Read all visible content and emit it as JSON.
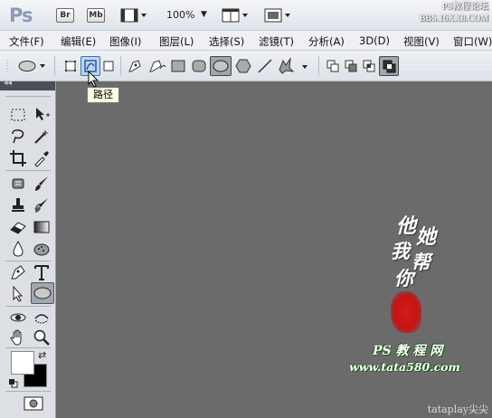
{
  "app": {
    "logo": "Ps",
    "bridge_button": "Br",
    "minibridge_button": "Mb",
    "zoom_level": "100%"
  },
  "watermark": {
    "line1": "PS教程论坛",
    "line2": "BBS.16XX8.COM",
    "calligraphy": [
      "他",
      "她",
      "我",
      "帮",
      "你"
    ],
    "brand_cn": "PS 教 程 网",
    "url": "www.tata580.com",
    "credit": "tataplay尖尖"
  },
  "menu": [
    "文件(F)",
    "编辑(E)",
    "图像(I)",
    "图层(L)",
    "选择(S)",
    "滤镜(T)",
    "分析(A)",
    "3D(D)",
    "视图(V)",
    "窗口(W)"
  ],
  "options_bar": {
    "tooltip": "路径"
  },
  "toolbox": {
    "collapse_glyph": "◂◂"
  },
  "colors": {
    "canvas": "#6b6b6b",
    "seal_red": "#c41414"
  }
}
